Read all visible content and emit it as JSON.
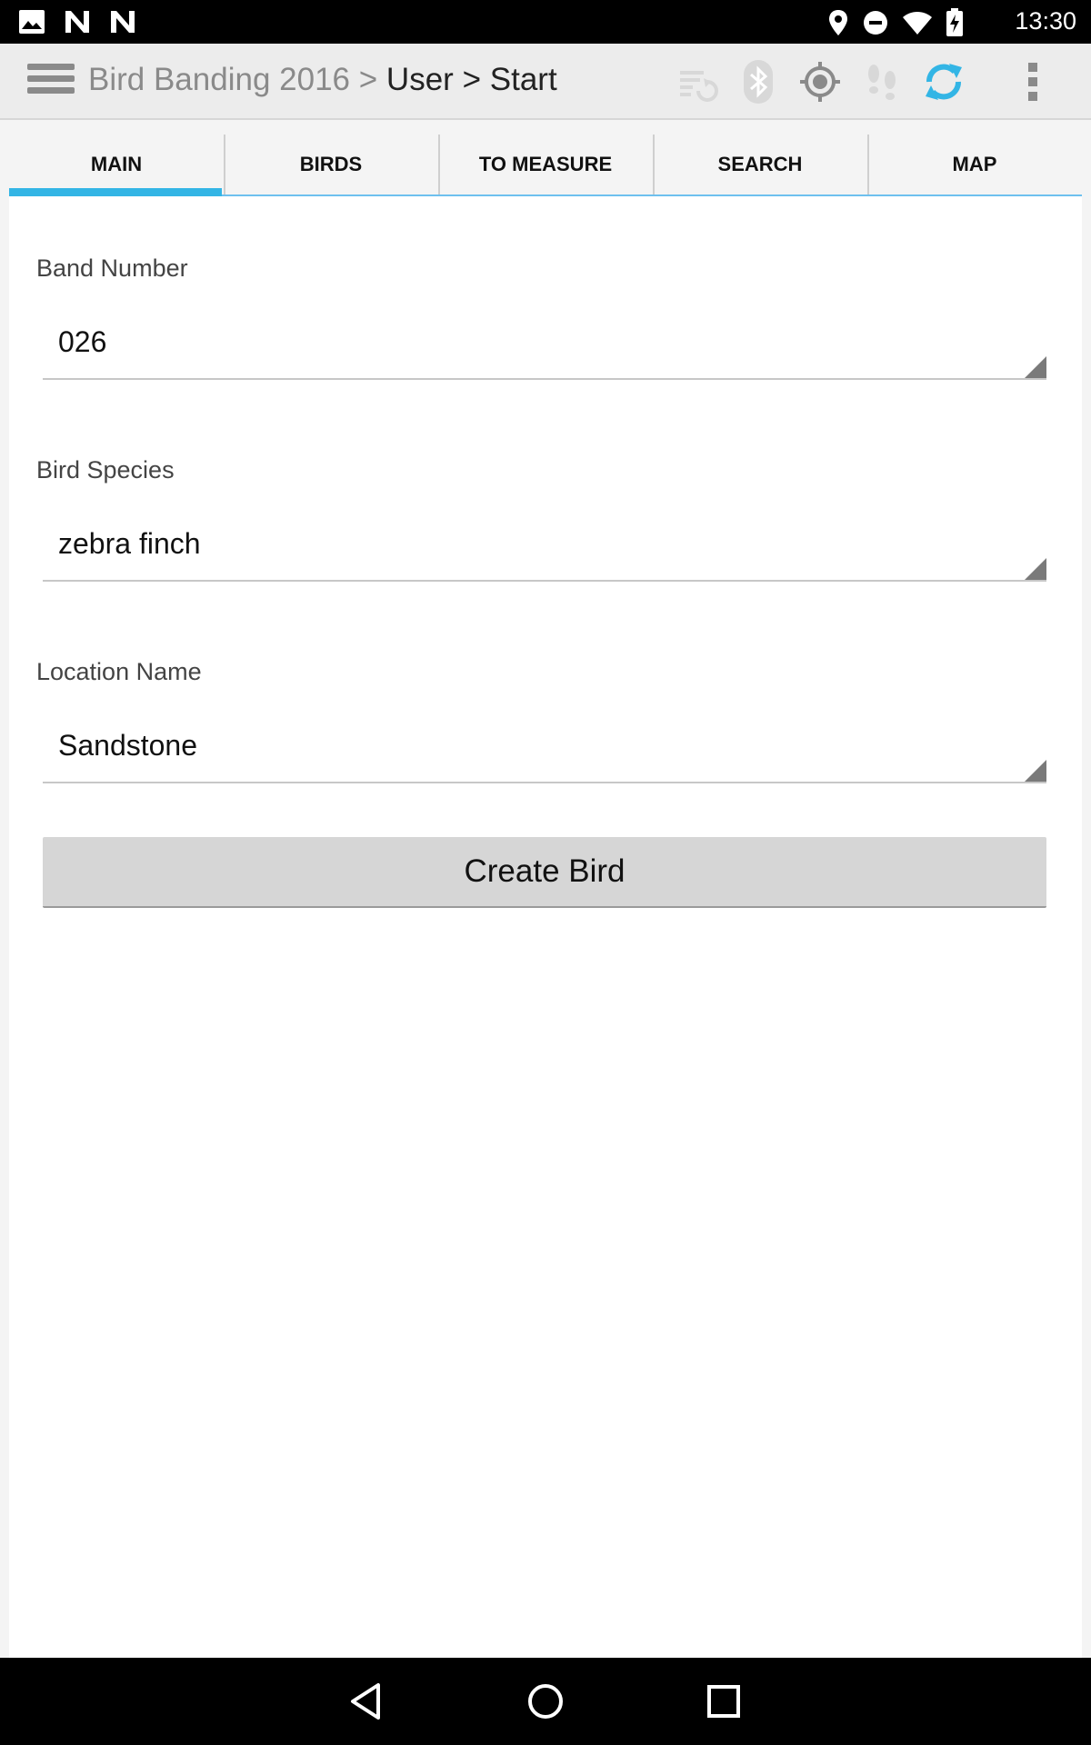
{
  "status_bar": {
    "time": "13:30",
    "left_icons": [
      "image-icon",
      "n-icon",
      "n-icon"
    ],
    "right_icons": [
      "location-icon",
      "do-not-disturb-icon",
      "wifi-icon",
      "battery-charging-icon"
    ]
  },
  "action_bar": {
    "app_name": "Bird Banding 2016",
    "sep1": ">",
    "crumb1": "User",
    "sep2": ">",
    "crumb2": "Start",
    "icons": [
      "sync-list-icon",
      "bluetooth-icon",
      "gps-target-icon",
      "footprints-icon",
      "refresh-icon",
      "overflow-menu-icon"
    ]
  },
  "tabs": [
    {
      "label": "MAIN",
      "active": true
    },
    {
      "label": "BIRDS"
    },
    {
      "label": "TO MEASURE"
    },
    {
      "label": "SEARCH"
    },
    {
      "label": "MAP"
    }
  ],
  "form": {
    "band_number": {
      "label": "Band Number",
      "value": "026"
    },
    "bird_species": {
      "label": "Bird Species",
      "value": "zebra finch"
    },
    "location_name": {
      "label": "Location Name",
      "value": "Sandstone"
    },
    "create_button": "Create Bird"
  },
  "nav_bar": [
    "back-icon",
    "home-icon",
    "recents-icon"
  ],
  "colors": {
    "accent": "#33b5e5",
    "tab_line": "#6ec0ee",
    "button": "#d6d6d6"
  }
}
